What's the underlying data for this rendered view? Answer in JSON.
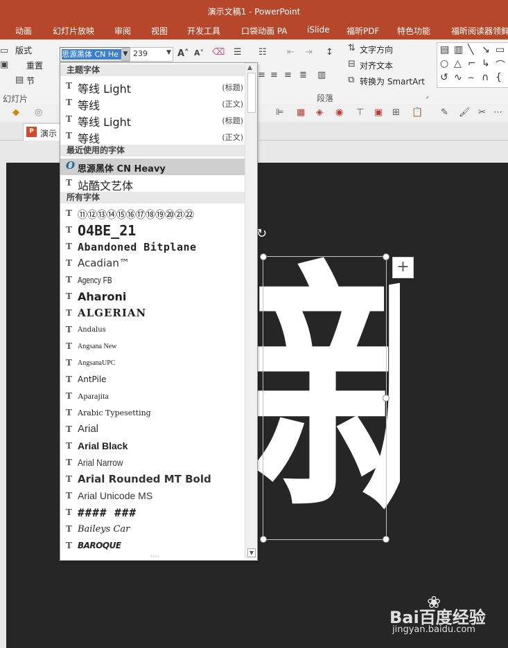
{
  "app": {
    "title": "演示文稿1 - PowerPoint"
  },
  "ribbon_tabs": [
    "动画",
    "幻灯片放映",
    "审阅",
    "视图",
    "开发工具",
    "口袋动画 PA",
    "iSlide",
    "福昕PDF",
    "特色功能",
    "福昕阅读器领鲜"
  ],
  "ribbon": {
    "layout": "版式",
    "reset": "重置",
    "section": "节",
    "group_slides": "幻灯片",
    "font_name": "思源黑体 CN He",
    "font_size": "239",
    "text_direction": "文字方向",
    "align_text": "对齐文本",
    "smartart": "转换为 SmartArt",
    "group_paragraph": "段落"
  },
  "doc_tab": {
    "badge": "P",
    "label": "演示"
  },
  "slide": {
    "big_char": "新"
  },
  "font_dropdown": {
    "theme_header": "主题字体",
    "theme_fonts": [
      {
        "name": "等线 Light",
        "tag": "(标题)"
      },
      {
        "name": "等线",
        "tag": "(正文)"
      },
      {
        "name": "等线 Light",
        "tag": "(标题)"
      },
      {
        "name": "等线",
        "tag": "(正文)"
      }
    ],
    "recent_header": "最近使用的字体",
    "recent_fonts": [
      "思源黑体 CN Heavy",
      "站酷文艺体"
    ],
    "all_header": "所有字体",
    "all_fonts": [
      "⑪⑫⑬⑭⑮⑯⑰⑱⑲⑳㉑㉒",
      "O4BE_21",
      "Abandoned Bitplane",
      "Acadian™",
      "Agency FB",
      "Aharoni",
      "ALGERIAN",
      "Andalus",
      "Angsana New",
      "AngsanaUPC",
      "AntPile",
      "Aparajita",
      "Arabic Typesetting",
      "Arial",
      "Arial Black",
      "Arial Narrow",
      "Arial Rounded MT Bold",
      "Arial Unicode MS",
      "#### ###",
      "Baileys Car",
      "BAROQUE"
    ],
    "grip": "....",
    "icons": {
      "truetype": "T",
      "opentype": "O"
    }
  },
  "watermark": {
    "brand": "Bai百度经验",
    "url": "jingyan.baidu.com"
  },
  "icons": {
    "rotate": "rotate-icon",
    "add": "plus-icon"
  }
}
